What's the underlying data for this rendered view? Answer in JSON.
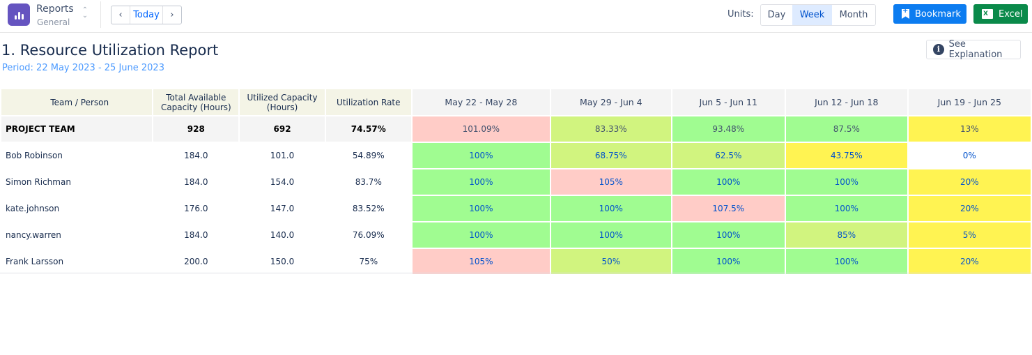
{
  "app": {
    "name": "Reports",
    "subtitle": "General",
    "icon": "bar-chart-icon"
  },
  "nav": {
    "prev_icon": "‹",
    "today_label": "Today",
    "next_icon": "›"
  },
  "units": {
    "label": "Units:",
    "options": [
      "Day",
      "Week",
      "Month"
    ],
    "selected": "Week"
  },
  "actions": {
    "bookmark_label": "Bookmark",
    "excel_label": "Excel"
  },
  "report": {
    "title": "1. Resource Utilization Report",
    "period": "Period: 22 May 2023 - 25 June 2023",
    "explain_label": "See Explanation"
  },
  "colors": {
    "over": "#ffccc7",
    "full": "#a0fc91",
    "medium": "#d1f47f",
    "low": "#fff352",
    "none": "#ffffff"
  },
  "table": {
    "headers": [
      "Team / Person",
      "Total Available Capacity (Hours)",
      "Utilized Capacity (Hours)",
      "Utilization Rate"
    ],
    "weeks": [
      "May 22 - May 28",
      "May 29 - Jun 4",
      "Jun 5 - Jun 11",
      "Jun 12 - Jun 18",
      "Jun 19 - Jun 25"
    ],
    "rows": [
      {
        "name": "PROJECT TEAM",
        "total": "928",
        "utilized": "692",
        "rate": "74.57%",
        "team": true,
        "weeks": [
          {
            "v": "101.09%",
            "c": "over"
          },
          {
            "v": "83.33%",
            "c": "medium"
          },
          {
            "v": "93.48%",
            "c": "full"
          },
          {
            "v": "87.5%",
            "c": "full"
          },
          {
            "v": "13%",
            "c": "low"
          }
        ]
      },
      {
        "name": "Bob Robinson",
        "total": "184.0",
        "utilized": "101.0",
        "rate": "54.89%",
        "weeks": [
          {
            "v": "100%",
            "c": "full"
          },
          {
            "v": "68.75%",
            "c": "medium"
          },
          {
            "v": "62.5%",
            "c": "medium"
          },
          {
            "v": "43.75%",
            "c": "low"
          },
          {
            "v": "0%",
            "c": "none"
          }
        ]
      },
      {
        "name": "Simon Richman",
        "total": "184.0",
        "utilized": "154.0",
        "rate": "83.7%",
        "weeks": [
          {
            "v": "100%",
            "c": "full"
          },
          {
            "v": "105%",
            "c": "over"
          },
          {
            "v": "100%",
            "c": "full"
          },
          {
            "v": "100%",
            "c": "full"
          },
          {
            "v": "20%",
            "c": "low"
          }
        ]
      },
      {
        "name": "kate.johnson",
        "total": "176.0",
        "utilized": "147.0",
        "rate": "83.52%",
        "weeks": [
          {
            "v": "100%",
            "c": "full"
          },
          {
            "v": "100%",
            "c": "full"
          },
          {
            "v": "107.5%",
            "c": "over"
          },
          {
            "v": "100%",
            "c": "full"
          },
          {
            "v": "20%",
            "c": "low"
          }
        ]
      },
      {
        "name": "nancy.warren",
        "total": "184.0",
        "utilized": "140.0",
        "rate": "76.09%",
        "weeks": [
          {
            "v": "100%",
            "c": "full"
          },
          {
            "v": "100%",
            "c": "full"
          },
          {
            "v": "100%",
            "c": "full"
          },
          {
            "v": "85%",
            "c": "medium"
          },
          {
            "v": "5%",
            "c": "low"
          }
        ]
      },
      {
        "name": "Frank Larsson",
        "total": "200.0",
        "utilized": "150.0",
        "rate": "75%",
        "weeks": [
          {
            "v": "105%",
            "c": "over"
          },
          {
            "v": "50%",
            "c": "medium"
          },
          {
            "v": "100%",
            "c": "full"
          },
          {
            "v": "100%",
            "c": "full"
          },
          {
            "v": "20%",
            "c": "low"
          }
        ]
      }
    ]
  }
}
